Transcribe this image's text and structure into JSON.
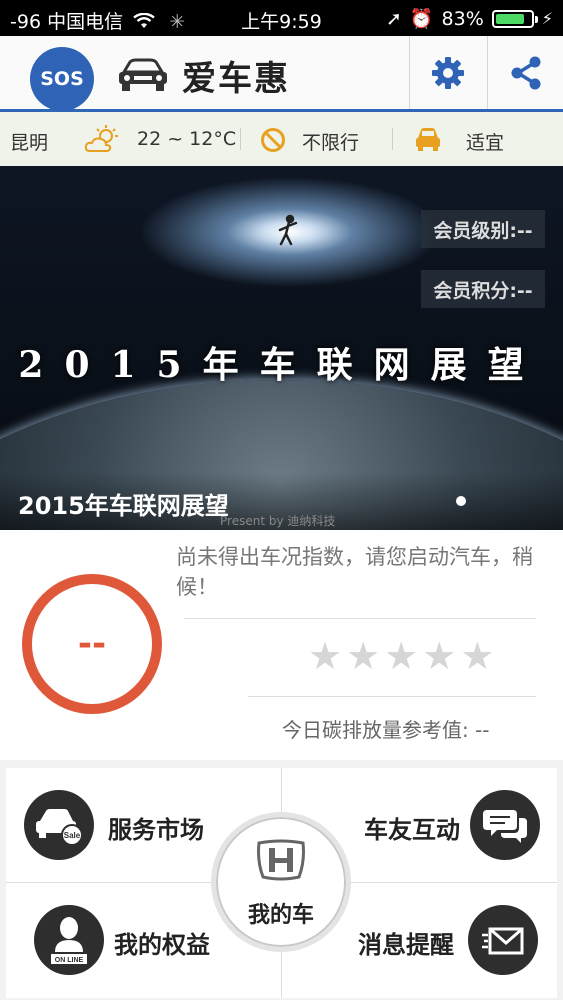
{
  "status_bar": {
    "signal": "-96",
    "carrier": "中国电信",
    "time": "上午9:59",
    "battery": "83%",
    "battery_level": 0.83
  },
  "header": {
    "sos_label": "SOS",
    "title": "爱车惠",
    "settings_icon": "gear-icon",
    "share_icon": "share-icon",
    "accent": "#2f66b8"
  },
  "info_bar": {
    "city": "昆明",
    "temperature": "22 ~ 12°C",
    "restriction": "不限行",
    "carwash": "适宜"
  },
  "banner": {
    "member_level": "会员级别:--",
    "member_points": "会员积分:--",
    "headline": "2015年车联网展望",
    "caption": "2015年车联网展望",
    "watermark": "Present by 迪纳科技"
  },
  "car_status": {
    "index_value": "--",
    "message": "尚未得出车况指数，请您启动汽车，稍候！",
    "rating": 0,
    "rating_max": 5,
    "carbon_label": "今日碳排放量参考值: --",
    "ring_color": "#e0583a"
  },
  "grid": {
    "service_market": "服务市场",
    "car_friends": "车友互动",
    "my_car": "我的车",
    "my_rights": "我的权益",
    "messages": "消息提醒",
    "sale_badge": "Sale",
    "online_badge": "ON LINE"
  }
}
